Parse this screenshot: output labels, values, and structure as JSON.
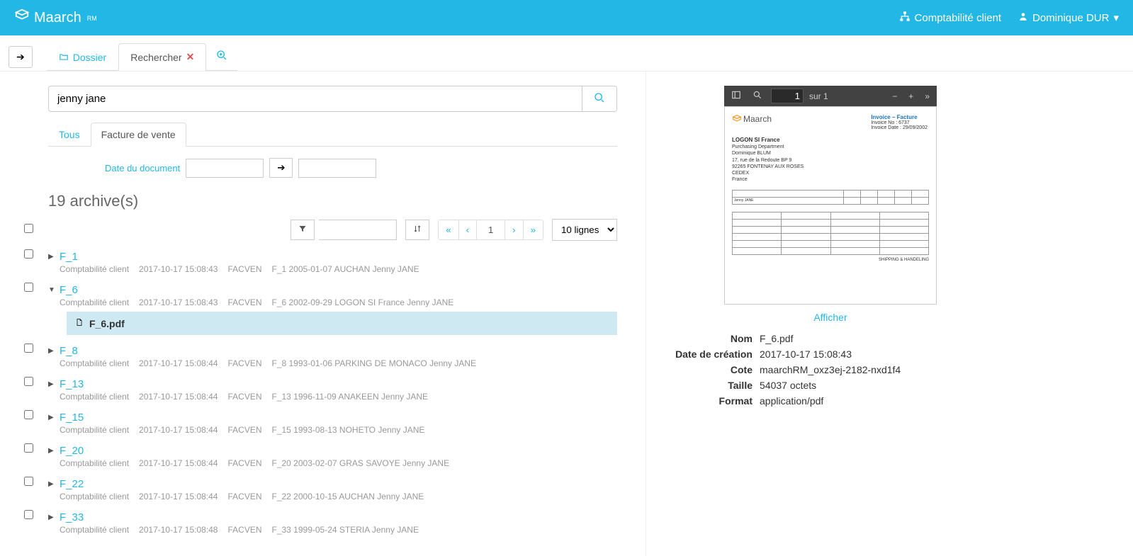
{
  "brand": {
    "name": "Maarch",
    "sub": "RM"
  },
  "header": {
    "org": "Comptabilité client",
    "user": "Dominique DUR"
  },
  "tabs": {
    "dossier": "Dossier",
    "rechercher": "Rechercher"
  },
  "search": {
    "value": "jenny jane"
  },
  "subtabs": {
    "all": "Tous",
    "active": "Facture de vente"
  },
  "dateFilter": {
    "label": "Date du document"
  },
  "count_text": "19 archive(s)",
  "pager": {
    "page": "1"
  },
  "lines": "10 lignes",
  "results": [
    {
      "id": "F_1",
      "expanded": false,
      "org": "Comptabilité client",
      "ts": "2017-10-17 15:08:43",
      "type": "FACVEN",
      "desc": "F_1 2005-01-07 AUCHAN Jenny JANE"
    },
    {
      "id": "F_6",
      "expanded": true,
      "org": "Comptabilité client",
      "ts": "2017-10-17 15:08:43",
      "type": "FACVEN",
      "desc": "F_6 2002-09-29 LOGON SI France Jenny JANE",
      "file": "F_6.pdf"
    },
    {
      "id": "F_8",
      "expanded": false,
      "org": "Comptabilité client",
      "ts": "2017-10-17 15:08:44",
      "type": "FACVEN",
      "desc": "F_8 1993-01-06 PARKING DE MONACO Jenny JANE"
    },
    {
      "id": "F_13",
      "expanded": false,
      "org": "Comptabilité client",
      "ts": "2017-10-17 15:08:44",
      "type": "FACVEN",
      "desc": "F_13 1996-11-09 ANAKEEN Jenny JANE"
    },
    {
      "id": "F_15",
      "expanded": false,
      "org": "Comptabilité client",
      "ts": "2017-10-17 15:08:44",
      "type": "FACVEN",
      "desc": "F_15 1993-08-13 NOHETO Jenny JANE"
    },
    {
      "id": "F_20",
      "expanded": false,
      "org": "Comptabilité client",
      "ts": "2017-10-17 15:08:44",
      "type": "FACVEN",
      "desc": "F_20 2003-02-07 GRAS SAVOYE Jenny JANE"
    },
    {
      "id": "F_22",
      "expanded": false,
      "org": "Comptabilité client",
      "ts": "2017-10-17 15:08:44",
      "type": "FACVEN",
      "desc": "F_22 2000-10-15 AUCHAN Jenny JANE"
    },
    {
      "id": "F_33",
      "expanded": false,
      "org": "Comptabilité client",
      "ts": "2017-10-17 15:08:48",
      "type": "FACVEN",
      "desc": "F_33 1999-05-24 STERIA Jenny JANE"
    }
  ],
  "preview": {
    "page_current": "1",
    "page_sep": "sur",
    "page_total": "1",
    "invoice_title": "Invoice – Facture",
    "invoice_no_label": "Invoice No :",
    "invoice_no": "6737",
    "invoice_date_label": "Invoice Date :",
    "invoice_date": "29/09/2002",
    "logo_text": "Maarch",
    "addr_company": "LOGON SI France",
    "addr_lines": [
      "Purchasing Department",
      "Dominique BLUM",
      "17, rue de la Redoute BP 9",
      "92265 FONTENAY AUX ROSES",
      "CEDEX",
      "France"
    ],
    "shipping": "SHIPPING & HANDELING",
    "afficher": "Afficher"
  },
  "details": {
    "labels": {
      "nom": "Nom",
      "created": "Date de création",
      "cote": "Cote",
      "taille": "Taille",
      "format": "Format"
    },
    "nom": "F_6.pdf",
    "created": "2017-10-17 15:08:43",
    "cote": "maarchRM_oxz3ej-2182-nxd1f4",
    "taille": "54037 octets",
    "format": "application/pdf"
  }
}
